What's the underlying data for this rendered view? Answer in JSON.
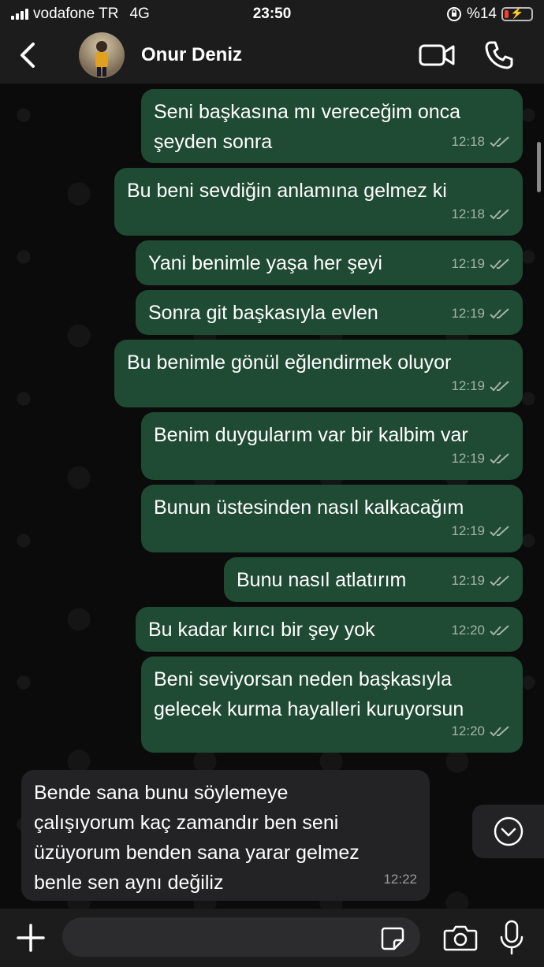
{
  "status_bar": {
    "carrier": "vodafone TR",
    "network": "4G",
    "time": "23:50",
    "battery": "%14"
  },
  "header": {
    "contact_name": "Onur Deniz"
  },
  "messages": [
    {
      "direction": "out",
      "text": "Seni başkasına mı vereceğim onca\nşeyden sonra",
      "time": "12:18"
    },
    {
      "direction": "out",
      "text": "Bu beni sevdiğin anlamına gelmez ki",
      "time": "12:18"
    },
    {
      "direction": "out",
      "text": "Yani benimle yaşa her şeyi",
      "time": "12:19"
    },
    {
      "direction": "out",
      "text": "Sonra git başkasıyla evlen",
      "time": "12:19"
    },
    {
      "direction": "out",
      "text": "Bu benimle gönül eğlendirmek oluyor",
      "time": "12:19"
    },
    {
      "direction": "out",
      "text": "Benim duygularım var bir kalbim var",
      "time": "12:19"
    },
    {
      "direction": "out",
      "text": "Bunun üstesinden nasıl kalkacağım",
      "time": "12:19"
    },
    {
      "direction": "out",
      "text": "Bunu nasıl atlatırım",
      "time": "12:19"
    },
    {
      "direction": "out",
      "text": "Bu kadar kırıcı bir şey yok",
      "time": "12:20"
    },
    {
      "direction": "out",
      "text": "Beni seviyorsan neden başkasıyla\ngelecek kurma hayalleri kuruyorsun",
      "time": "12:20"
    },
    {
      "direction": "in",
      "text": "Bende sana bunu söylemeye\nçalışıyorum kaç zamandır ben seni\nüzüyorum benden sana yarar gelmez\nbenle sen aynı değiliz",
      "time": "12:22"
    }
  ],
  "input": {
    "value": "",
    "placeholder": ""
  },
  "colors": {
    "outgoing_bubble": "#1f4a33",
    "incoming_bubble": "#232325",
    "background": "#0b0b0b",
    "bar": "#1c1c1d"
  },
  "icons": {
    "back": "chevron-left",
    "video": "video-camera",
    "call": "phone",
    "scroll_down": "chevron-down-circle",
    "plus": "plus",
    "sticker": "sticker",
    "camera": "camera",
    "mic": "microphone"
  }
}
